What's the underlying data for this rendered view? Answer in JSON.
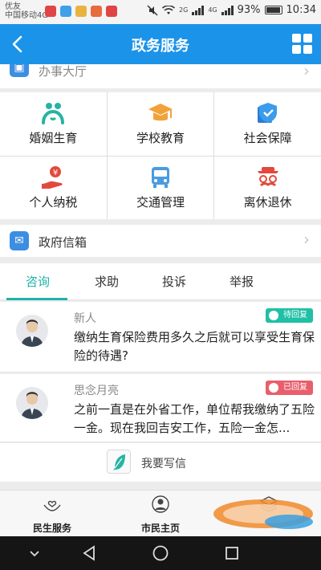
{
  "status_bar": {
    "carrier_line1": "优友",
    "carrier_line2": "中国移动4G",
    "net_2g": "2G",
    "net_4g": "4G",
    "battery": "93%",
    "time": "10:34"
  },
  "header": {
    "title": "政务服务"
  },
  "office_hall": {
    "label": "办事大厅"
  },
  "services": [
    {
      "label": "婚姻生育",
      "icon": "marriage-icon"
    },
    {
      "label": "学校教育",
      "icon": "graduation-cap-icon"
    },
    {
      "label": "社会保障",
      "icon": "social-security-icon"
    },
    {
      "label": "个人纳税",
      "icon": "tax-icon"
    },
    {
      "label": "交通管理",
      "icon": "bus-icon"
    },
    {
      "label": "离休退休",
      "icon": "retirement-icon"
    }
  ],
  "mailbox": {
    "label": "政府信箱"
  },
  "tabs": [
    {
      "label": "咨询",
      "active": true
    },
    {
      "label": "求助"
    },
    {
      "label": "投诉"
    },
    {
      "label": "举报"
    }
  ],
  "messages": [
    {
      "sender": "新人",
      "status": "待回复",
      "text": "缴纳生育保险费用多久之后就可以享受生育保险的待遇?"
    },
    {
      "sender": "思念月亮",
      "status": "已回复",
      "text": "之前一直是在外省工作，单位帮我缴纳了五险一金。现在我回吉安工作，五险一金怎..."
    }
  ],
  "write_letter": {
    "label": "我要写信"
  },
  "bottom_nav": [
    {
      "label": "民生服务",
      "icon": "hands-heart-icon"
    },
    {
      "label": "市民主页",
      "icon": "person-icon"
    },
    {
      "label": "",
      "icon": "layers-icon"
    }
  ],
  "colors": {
    "brand": "#1b93e8",
    "accent": "#1fb3a6",
    "pending": "#1fc0a5",
    "replied": "#e85f6c"
  }
}
